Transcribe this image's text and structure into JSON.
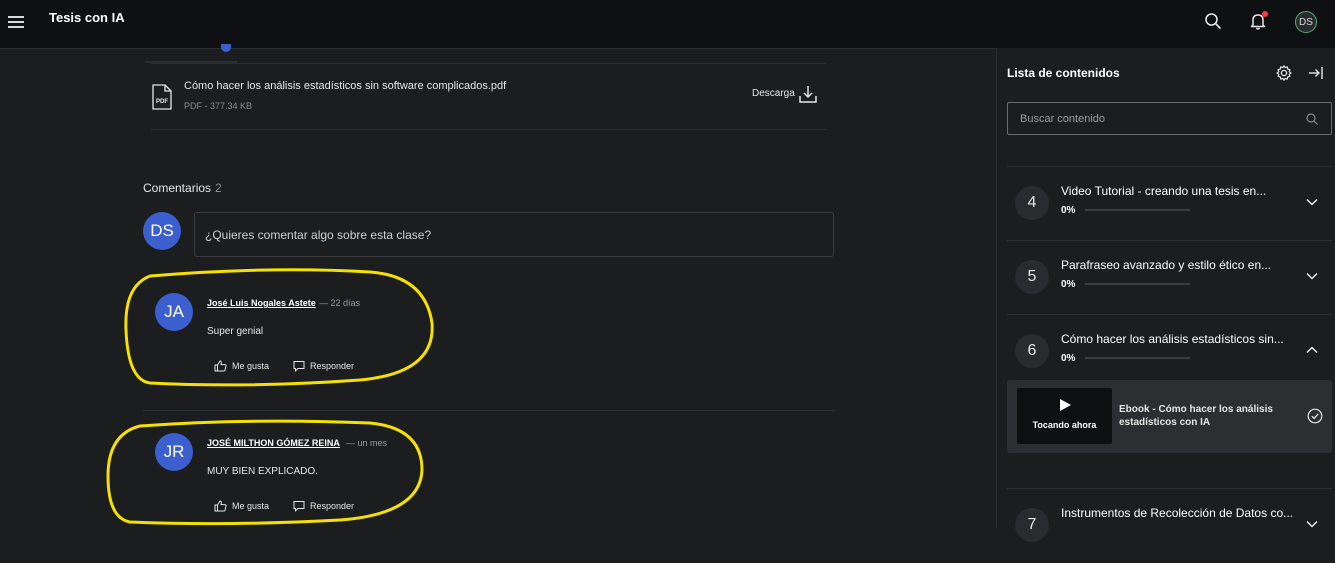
{
  "app": {
    "title": "Tesis con IA",
    "avatar_initials": "DS"
  },
  "file": {
    "name": "Cómo hacer los análisis estadísticos sin software complicados.pdf",
    "meta": "PDF - 377.34 KB",
    "download_label": "Descarga",
    "icon_label": "PDF"
  },
  "comments": {
    "title": "Comentarios",
    "count": "2",
    "input_placeholder": "¿Quieres comentar algo sobre esta clase?",
    "current_user_initials": "DS",
    "items": [
      {
        "initials": "JA",
        "author": "José Luis Nogales Astete",
        "time": "— 22 días",
        "text": "Super genial",
        "like_label": "Me gusta",
        "reply_label": "Responder"
      },
      {
        "initials": "JR",
        "author": "JOSÉ MILTHON GÓMEZ REINA",
        "time": "— un mes",
        "text": "MUY BIEN EXPLICADO.",
        "like_label": "Me gusta",
        "reply_label": "Responder"
      }
    ]
  },
  "sidebar": {
    "title": "Lista de contenidos",
    "search_placeholder": "Buscar contenido",
    "items": [
      {
        "number": "4",
        "title": "Video Tutorial - creando una tesis en...",
        "progress_label": "0%",
        "progress": 0,
        "expanded": false
      },
      {
        "number": "5",
        "title": "Parafraseo avanzado y estilo ético en...",
        "progress_label": "0%",
        "progress": 0,
        "expanded": false
      },
      {
        "number": "6",
        "title": "Cómo hacer los análisis estadísticos sin...",
        "progress_label": "0%",
        "progress": 0,
        "expanded": true
      },
      {
        "number": "7",
        "title": "Instrumentos de Recolección de Datos co...",
        "progress_label": "",
        "progress": 0,
        "expanded": false
      }
    ],
    "now_playing": {
      "label": "Tocando ahora",
      "title": "Ebook - Cómo hacer los análisis estadísticos con IA"
    }
  },
  "colors": {
    "accent": "#3b5fcf",
    "highlight": "#f5e000",
    "progress": "#4caf78",
    "notification": "#ff3b3b"
  }
}
